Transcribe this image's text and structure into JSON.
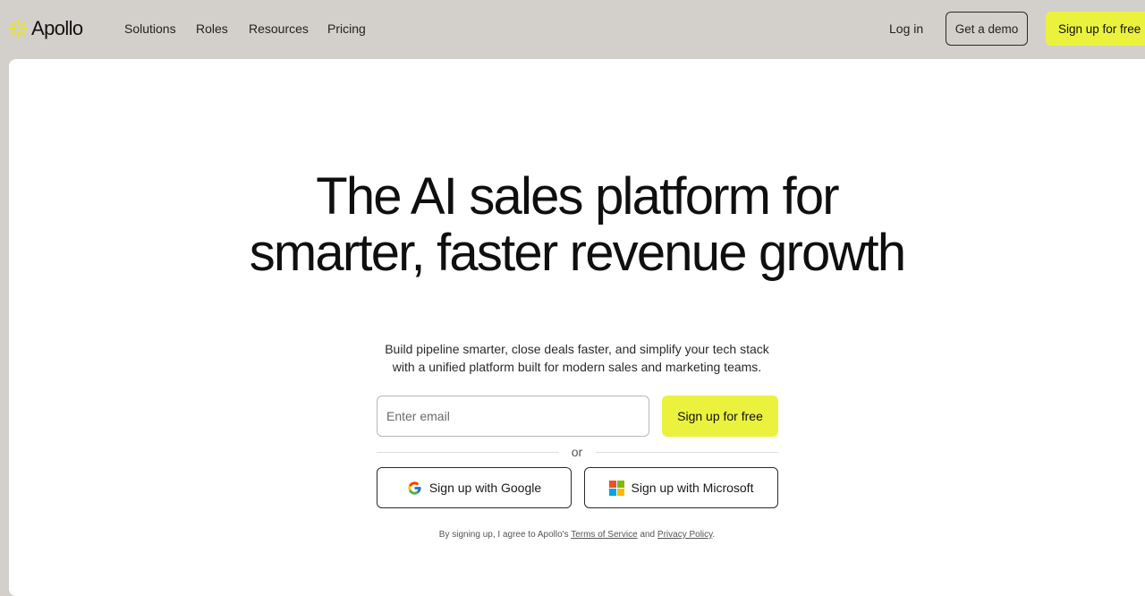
{
  "brand": {
    "name": "Apollo",
    "accent_color": "#ebf23d",
    "icon": "apollo-sun-icon"
  },
  "nav": {
    "items": [
      "Solutions",
      "Roles",
      "Resources",
      "Pricing"
    ],
    "login_label": "Log in",
    "demo_label": "Get a demo",
    "signup_label": "Sign up for free"
  },
  "hero": {
    "title_line1": "The AI sales platform for",
    "title_line2": "smarter, faster revenue growth",
    "subtitle_line1": "Build pipeline smarter, close deals faster, and simplify your tech stack",
    "subtitle_line2": "with a unified platform built for modern sales and marketing teams."
  },
  "signup_form": {
    "email_placeholder": "Enter email",
    "email_value": "",
    "submit_label": "Sign up for free",
    "or_label": "or",
    "google_label": "Sign up with Google",
    "microsoft_label": "Sign up with Microsoft"
  },
  "legal": {
    "prefix": "By signing up, I agree to Apollo's",
    "terms_label": "Terms of Service",
    "and_label": "and",
    "privacy_label": "Privacy Policy",
    "suffix": "."
  },
  "colors": {
    "page_background": "#d3d0cb",
    "card_background": "#ffffff",
    "text": "#1a1a1a"
  }
}
